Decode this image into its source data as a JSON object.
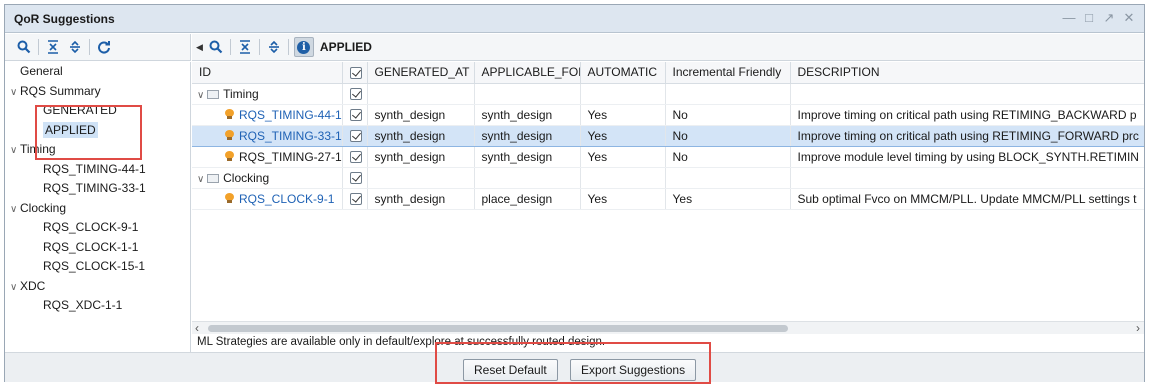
{
  "window": {
    "title": "QoR Suggestions",
    "controls": [
      "minimize-icon",
      "maximize-icon",
      "float-icon",
      "close-icon"
    ]
  },
  "left_toolbar": {
    "icons": [
      "search-icon",
      "collapse-all-icon",
      "expand-all-icon",
      "refresh-icon"
    ]
  },
  "right_toolbar": {
    "icons": [
      "search-icon",
      "collapse-all-icon",
      "expand-all-icon",
      "info-icon"
    ],
    "view_label": "APPLIED"
  },
  "tree": {
    "items": [
      {
        "label": "General",
        "indent": 0,
        "expandable": false
      },
      {
        "label": "RQS Summary",
        "indent": 0,
        "expandable": true
      },
      {
        "label": "GENERATED",
        "indent": 1,
        "expandable": false
      },
      {
        "label": "APPLIED",
        "indent": 1,
        "expandable": false,
        "selected": true
      },
      {
        "label": "Timing",
        "indent": 0,
        "expandable": true
      },
      {
        "label": "RQS_TIMING-44-1",
        "indent": 1,
        "expandable": false
      },
      {
        "label": "RQS_TIMING-33-1",
        "indent": 1,
        "expandable": false
      },
      {
        "label": "Clocking",
        "indent": 0,
        "expandable": true
      },
      {
        "label": "RQS_CLOCK-9-1",
        "indent": 1,
        "expandable": false
      },
      {
        "label": "RQS_CLOCK-1-1",
        "indent": 1,
        "expandable": false
      },
      {
        "label": "RQS_CLOCK-15-1",
        "indent": 1,
        "expandable": false
      },
      {
        "label": "XDC",
        "indent": 0,
        "expandable": true
      },
      {
        "label": "RQS_XDC-1-1",
        "indent": 1,
        "expandable": false
      }
    ]
  },
  "table": {
    "columns": [
      "ID",
      "",
      "GENERATED_AT",
      "APPLICABLE_FOR",
      "AUTOMATIC",
      "Incremental Friendly",
      "DESCRIPTION"
    ],
    "rows": [
      {
        "type": "group",
        "id": "Timing",
        "checked": true
      },
      {
        "type": "item",
        "id": "RQS_TIMING-44-1",
        "link": true,
        "checked": true,
        "generated_at": "synth_design",
        "applicable_for": "synth_design",
        "automatic": "Yes",
        "incremental": "No",
        "description": "Improve timing on critical path using RETIMING_BACKWARD p"
      },
      {
        "type": "item",
        "id": "RQS_TIMING-33-1",
        "link": true,
        "checked": true,
        "selected": true,
        "generated_at": "synth_design",
        "applicable_for": "synth_design",
        "automatic": "Yes",
        "incremental": "No",
        "description": "Improve timing on critical path using RETIMING_FORWARD prc"
      },
      {
        "type": "item",
        "id": "RQS_TIMING-27-1",
        "link": false,
        "checked": true,
        "generated_at": "synth_design",
        "applicable_for": "synth_design",
        "automatic": "Yes",
        "incremental": "No",
        "description": "Improve module level timing by using BLOCK_SYNTH.RETIMIN"
      },
      {
        "type": "group",
        "id": "Clocking",
        "checked": true
      },
      {
        "type": "item",
        "id": "RQS_CLOCK-9-1",
        "link": true,
        "checked": true,
        "generated_at": "synth_design",
        "applicable_for": "place_design",
        "automatic": "Yes",
        "incremental": "Yes",
        "description": "Sub optimal Fvco on MMCM/PLL. Update MMCM/PLL settings t"
      }
    ]
  },
  "note": "ML Strategies are available only in default/explore at successfully routed design.",
  "buttons": {
    "reset": "Reset Default",
    "export": "Export Suggestions"
  }
}
